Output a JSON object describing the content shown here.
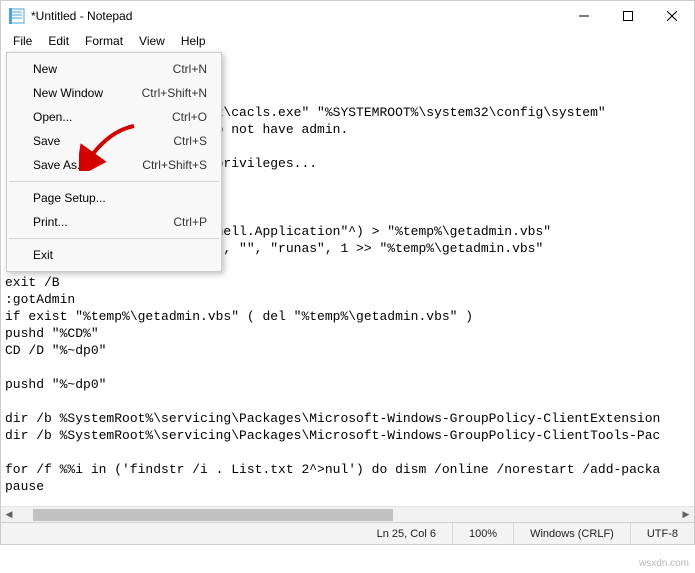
{
  "title": "*Untitled - Notepad",
  "menus": {
    "file": "File",
    "edit": "Edit",
    "format": "Format",
    "view": "View",
    "help": "Help"
  },
  "fileMenu": {
    "new": {
      "label": "New",
      "shortcut": "Ctrl+N"
    },
    "newWindow": {
      "label": "New Window",
      "shortcut": "Ctrl+Shift+N"
    },
    "open": {
      "label": "Open...",
      "shortcut": "Ctrl+O"
    },
    "save": {
      "label": "Save",
      "shortcut": "Ctrl+S"
    },
    "saveAs": {
      "label": "Save As...",
      "shortcut": "Ctrl+Shift+S"
    },
    "pageSetup": {
      "label": "Page Setup...",
      "shortcut": ""
    },
    "print": {
      "label": "Print...",
      "shortcut": "Ctrl+P"
    },
    "exit": {
      "label": "Exit",
      "shortcut": ""
    }
  },
  "editorText": "\n\n\n                        em32\\cacls.exe\" \"%SYSTEMROOT%\\system32\\config\\system\"\n                        e do not have admin.\n\n                        ve privileges...\n\n\n\n                        (\"Shell.Application\"^) > \"%temp%\\getadmin.vbs\"\n                        , \"\", \"\", \"runas\", 1 >> \"%temp%\\getadmin.vbs\"\n\"%temp%\\getadmin.vbs\"\nexit /B\n:gotAdmin\nif exist \"%temp%\\getadmin.vbs\" ( del \"%temp%\\getadmin.vbs\" )\npushd \"%CD%\"\nCD /D \"%~dp0\"\n\npushd \"%~dp0\"\n\ndir /b %SystemRoot%\\servicing\\Packages\\Microsoft-Windows-GroupPolicy-ClientExtension\ndir /b %SystemRoot%\\servicing\\Packages\\Microsoft-Windows-GroupPolicy-ClientTools-Pac\n\nfor /f %%i in ('findstr /i . List.txt 2^>nul') do dism /online /norestart /add-packa\npause",
  "status": {
    "caret": "Ln 25, Col 6",
    "zoom": "100%",
    "eol": "Windows (CRLF)",
    "encoding": "UTF-8"
  },
  "watermark": "wsxdn.com"
}
